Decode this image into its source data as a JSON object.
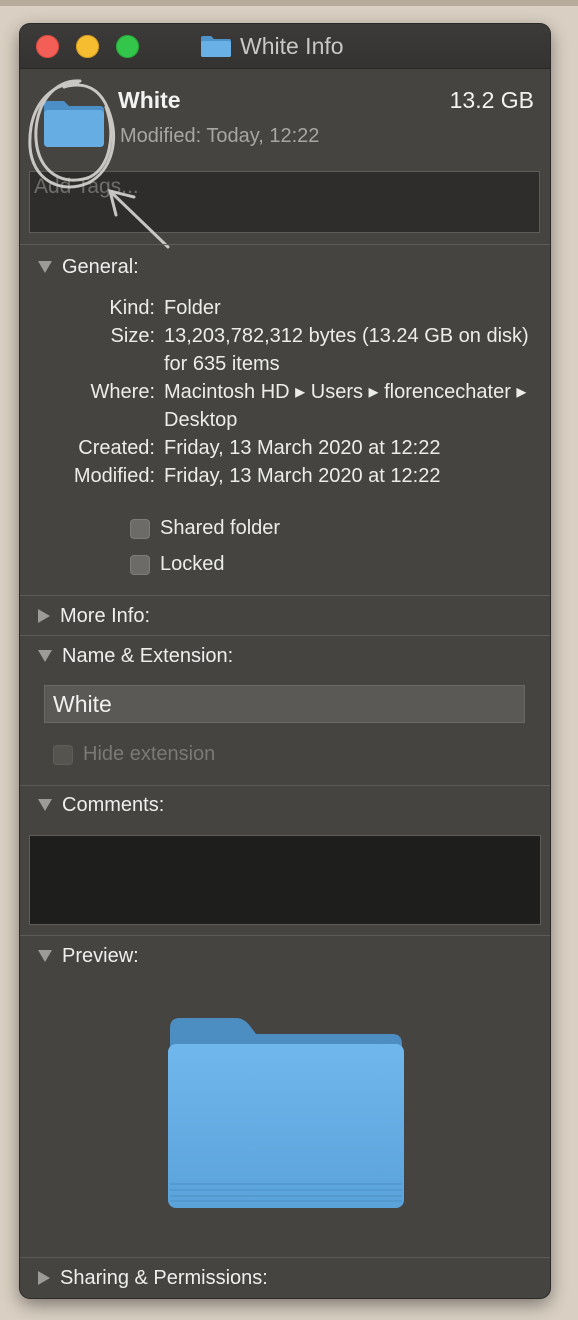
{
  "window": {
    "title": "White Info"
  },
  "header": {
    "name": "White",
    "size": "13.2 GB",
    "modified": "Modified: Today, 12:22",
    "tags_placeholder": "Add Tags..."
  },
  "general": {
    "heading": "General:",
    "rows": [
      {
        "label": "Kind:",
        "value": "Folder"
      },
      {
        "label": "Size:",
        "value": "13,203,782,312 bytes (13.24 GB on disk) for 635 items"
      },
      {
        "label": "Where:",
        "value": "Macintosh HD ▸ Users ▸ florencechater ▸ Desktop"
      },
      {
        "label": "Created:",
        "value": "Friday, 13 March 2020 at 12:22"
      },
      {
        "label": "Modified:",
        "value": "Friday, 13 March 2020 at 12:22"
      }
    ],
    "shared_folder_label": "Shared folder",
    "locked_label": "Locked"
  },
  "more_info": {
    "heading": "More Info:"
  },
  "name_extension": {
    "heading": "Name & Extension:",
    "name_value": "White",
    "hide_extension_label": "Hide extension"
  },
  "comments": {
    "heading": "Comments:"
  },
  "preview": {
    "heading": "Preview:"
  },
  "sharing": {
    "heading": "Sharing & Permissions:"
  },
  "colors": {
    "window_bg": "#454441",
    "folder_blue": "#5fa5dc",
    "close": "#f35f57",
    "minimize": "#f5bd2f",
    "zoom": "#33c64a"
  },
  "icons": [
    "close-icon",
    "minimize-icon",
    "zoom-icon",
    "folder-icon",
    "disclosure-triangle-icon",
    "annotation-scribble"
  ]
}
